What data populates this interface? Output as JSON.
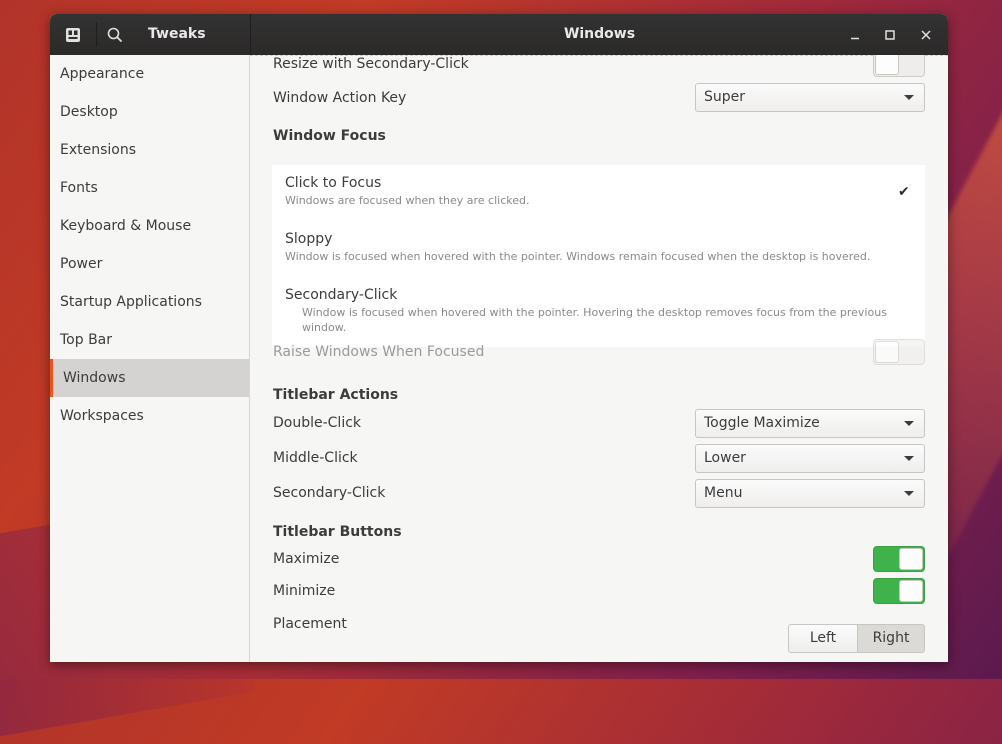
{
  "header": {
    "app_title": "Tweaks",
    "window_title": "Windows",
    "icons": [
      "app-menu-icon",
      "search-icon",
      "minimize-icon",
      "maximize-icon",
      "close-icon"
    ]
  },
  "sidebar": {
    "items": [
      {
        "label": "Appearance"
      },
      {
        "label": "Desktop"
      },
      {
        "label": "Extensions"
      },
      {
        "label": "Fonts"
      },
      {
        "label": "Keyboard & Mouse"
      },
      {
        "label": "Power"
      },
      {
        "label": "Startup Applications"
      },
      {
        "label": "Top Bar"
      },
      {
        "label": "Windows",
        "selected": true
      },
      {
        "label": "Workspaces"
      }
    ]
  },
  "main": {
    "resize_secondary_click": {
      "label": "Resize with Secondary-Click",
      "value": false
    },
    "window_action_key": {
      "label": "Window Action Key",
      "value": "Super"
    },
    "window_focus": {
      "heading": "Window Focus",
      "options": [
        {
          "title": "Click to Focus",
          "description": "Windows are focused when they are clicked.",
          "selected": true
        },
        {
          "title": "Sloppy",
          "description": "Window is focused when hovered with the pointer. Windows remain focused when the desktop is hovered.",
          "selected": false
        },
        {
          "title": "Secondary-Click",
          "description": "Window is focused when hovered with the pointer. Hovering the desktop removes focus from the previous window.",
          "selected": false
        }
      ],
      "check_mark": "✔"
    },
    "raise_windows": {
      "label": "Raise Windows When Focused",
      "value": false
    },
    "titlebar_actions": {
      "heading": "Titlebar Actions",
      "double_click": {
        "label": "Double-Click",
        "value": "Toggle Maximize"
      },
      "middle_click": {
        "label": "Middle-Click",
        "value": "Lower"
      },
      "secondary_click": {
        "label": "Secondary-Click",
        "value": "Menu"
      }
    },
    "titlebar_buttons": {
      "heading": "Titlebar Buttons",
      "maximize": {
        "label": "Maximize",
        "value": true
      },
      "minimize": {
        "label": "Minimize",
        "value": true
      },
      "placement": {
        "label": "Placement",
        "options": [
          "Left",
          "Right"
        ],
        "selected": "Right"
      }
    }
  },
  "colors": {
    "accent": "#e95420",
    "switch_on": "#3fb24b",
    "header_bg": "#2f2e2d"
  }
}
